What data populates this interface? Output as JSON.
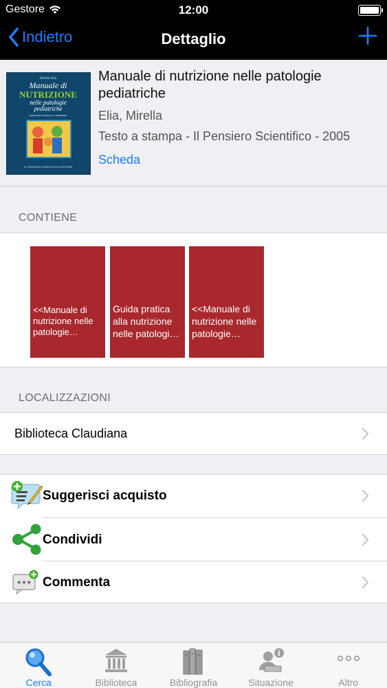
{
  "status_bar": {
    "carrier": "Gestore",
    "time": "12:00"
  },
  "nav": {
    "back_label": "Indietro",
    "title": "Dettaglio"
  },
  "record": {
    "title": "Manuale di nutrizione nelle patologie pediatriche",
    "author": "Elia, Mirella",
    "publication": "Testo a stampa - Il Pensiero Scientifico - 2005",
    "details_link": "Scheda",
    "cover": {
      "series": "Mirella Elia",
      "title_line1": "Manuale di",
      "title_line2": "NUTRIZIONE",
      "title_line3": "nelle patologie",
      "title_line4": "pediatriche",
      "subtitle": "Indicazioni cliniche e dietetiche",
      "publisher": "IL PENSIERO SCIENTIFICO EDITORE"
    }
  },
  "contains": {
    "header": "CONTIENE",
    "items": [
      {
        "text": "<<Manuale di nutrizione nelle patologie pediatriche"
      },
      {
        "text": "Guida pratica alla nutrizione nelle patologie pediatriche"
      },
      {
        "text": "<<Manuale di nutrizione nelle patologie pediatriche"
      }
    ]
  },
  "locations": {
    "header": "LOCALIZZAZIONI",
    "items": [
      {
        "label": "Biblioteca Claudiana"
      }
    ]
  },
  "actions": [
    {
      "label": "Suggerisci acquisto",
      "icon": "suggest-purchase-icon"
    },
    {
      "label": "Condividi",
      "icon": "share-icon"
    },
    {
      "label": "Commenta",
      "icon": "comment-icon"
    }
  ],
  "tabbar": {
    "tabs": [
      {
        "label": "Cerca",
        "icon": "search-icon",
        "active": true
      },
      {
        "label": "Biblioteca",
        "icon": "library-icon",
        "active": false
      },
      {
        "label": "Bibliografia",
        "icon": "books-icon",
        "active": false
      },
      {
        "label": "Situazione",
        "icon": "user-status-icon",
        "active": false
      },
      {
        "label": "Altro",
        "icon": "more-icon",
        "active": false
      }
    ]
  },
  "colors": {
    "accent": "#1a7dff",
    "tile": "#a8282d",
    "background": "#efeff4"
  }
}
